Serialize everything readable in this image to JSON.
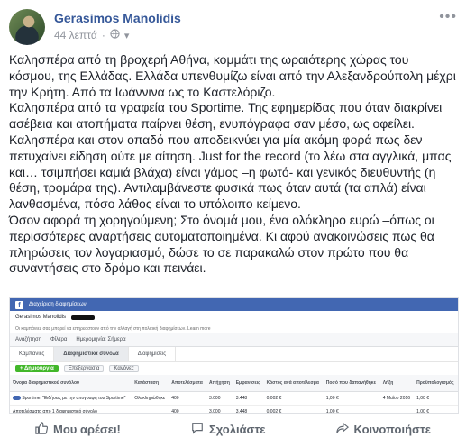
{
  "post": {
    "author": "Gerasimos Manolidis",
    "time": "44 λεπτά",
    "privacy_icon": "globe-icon",
    "more_label": "•••",
    "paragraphs": [
      "Καλησπέρα από τη βροχερή Αθήνα, κομμάτι της ωραιότερης χώρας του κόσμου, της Ελλάδας. Ελλάδα υπενθυμίζω είναι από την Αλεξανδρούπολη μέχρι την Κρήτη. Από τα Ιωάννινα ως το Καστελόριζο.",
      "Καλησπέρα από τα γραφεία του Sportime. Της εφημερίδας που όταν διακρίνει ασέβεια και ατοπήματα παίρνει θέση, ενυπόγραφα σαν μέσο, ως οφείλει.",
      "Καλησπέρα και στον οπαδό που αποδεικνύει για μία ακόμη φορά πως δεν πετυχαίνει είδηση ούτε με αίτηση. Just for the record (το λέω στα αγγλικά, μπας και… τσιμπήσει καμιά βλάχα) είναι γάμος –η φωτό- και γενικός διευθυντής (η θέση, τρομάρα της). Αντιλαμβάνεστε φυσικά πως όταν αυτά (τα απλά) είναι λανθασμένα, πόσο λάθος είναι το υπόλοιπο κείμενο.",
      "Όσον αφορά τη χορηγούμενη; Στο όνομά μου, ένα ολόκληρο ευρώ –όπως οι περισσότερες αναρτήσεις αυτοματοποιημένα. Κι αφού ανακοινώσεις πως θα πληρώσεις τον λογαριασμό, δώσε το σε παρακαλώ στον πρώτο που θα συναντήσεις στο δρόμο και πεινάει."
    ]
  },
  "screenshot": {
    "topbar_title": "Διαχείριση διαφημίσεων",
    "account_name": "Gerasimos Manolidis",
    "info_text": "Οι καμπάνιες σας μπορεί να επηρεαστούν από την αλλαγή στη πολιτική διαφημίσεων. Learn more",
    "toolbar": [
      "Αναζήτηση",
      "Φίλτρα",
      "Ημερομηνία: Σήμερα"
    ],
    "tabs": [
      "Καμπάνιες",
      "Διαφημιστικά σύνολα",
      "Διαφημίσεις"
    ],
    "create_label": "+ Δημιουργία",
    "buttons": [
      "Επεξεργασία",
      "Κανόνες"
    ],
    "columns": [
      "Όνομα διαφημιστικού συνόλου",
      "Κατάσταση",
      "Αποτελέσματα",
      "Απήχηση",
      "Εμφανίσεις",
      "Κόστος ανά αποτέλεσμα",
      "Ποσό που δαπανήθηκε",
      "Λήξη",
      "Προϋπολογισμός"
    ],
    "rows": [
      [
        "Sportime: \"Ειδήσεις με την υπογραφή του Sportime\"",
        "Ολοκληρώθηκε",
        "400",
        "3.000",
        "3.448",
        "0,002 €",
        "1,00 €",
        "4 Μαΐου 2016",
        "1,00 €"
      ],
      [
        "Αποτελέσματα από 1 διαφημιστικό σύνολο",
        "",
        "400",
        "3.000",
        "3.448",
        "0,002 €",
        "1,00 €",
        "",
        "1,00 €"
      ]
    ]
  },
  "footer": {
    "like": "Μου αρέσει!",
    "comment": "Σχολιάστε",
    "share": "Κοινοποιήστε"
  }
}
